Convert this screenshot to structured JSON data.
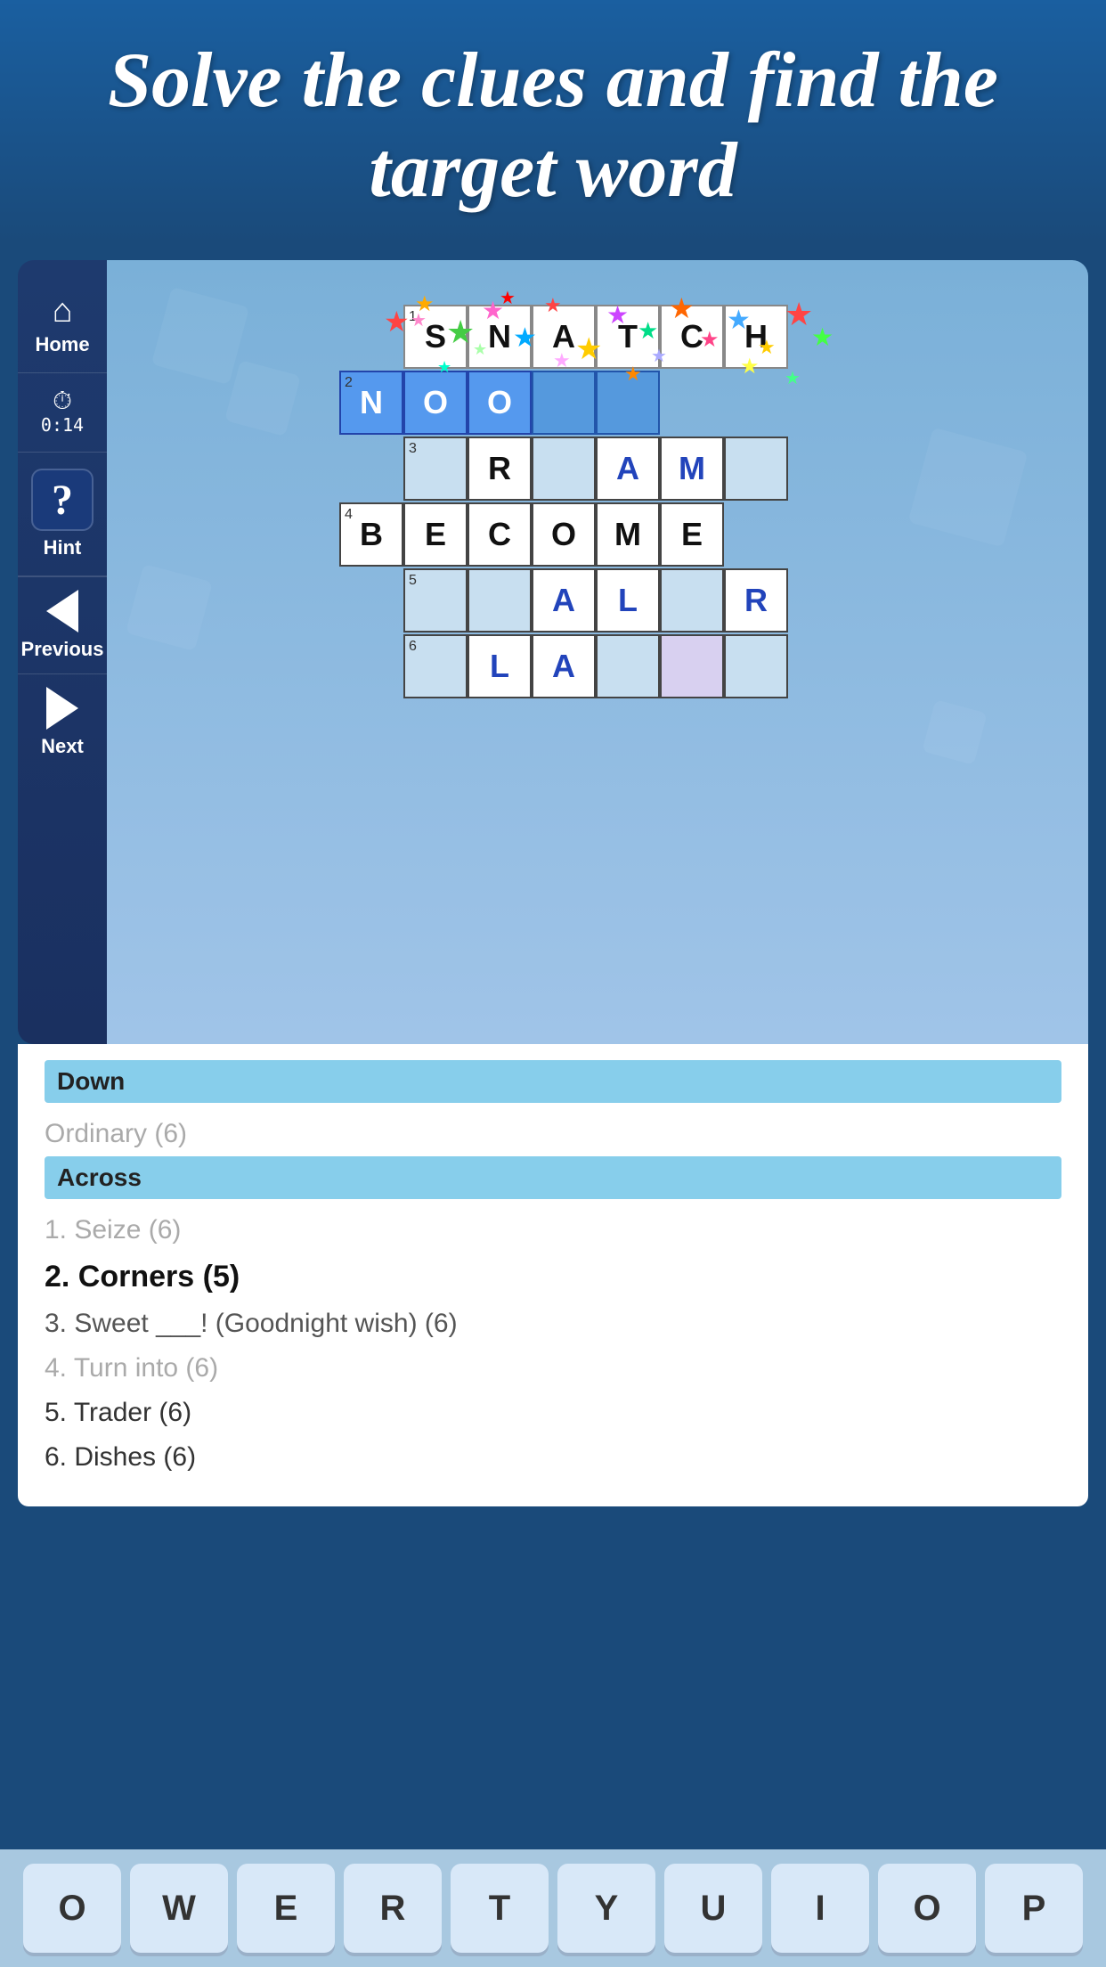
{
  "header": {
    "title": "Solve the clues and find the target word"
  },
  "sidebar": {
    "home_label": "Home",
    "timer_label": "0:14",
    "hint_label": "Hint",
    "hint_symbol": "?",
    "previous_label": "Previous",
    "next_label": "Next"
  },
  "grid": {
    "rows": [
      {
        "clue_num": "1",
        "cells": [
          "S",
          "N",
          "A",
          "T",
          "C",
          "H"
        ]
      },
      {
        "clue_num": "2",
        "cells": [
          "N",
          "O",
          "O",
          "",
          "",
          ""
        ]
      },
      {
        "clue_num": "3",
        "cells": [
          "R",
          "",
          "A",
          "M",
          "",
          ""
        ]
      },
      {
        "clue_num": "4",
        "cells": [
          "B",
          "E",
          "C",
          "O",
          "M",
          "E"
        ]
      },
      {
        "clue_num": "5",
        "cells": [
          "",
          "A",
          "L",
          "",
          "R",
          ""
        ]
      },
      {
        "clue_num": "6",
        "cells": [
          "L",
          "A",
          "",
          "",
          "",
          ""
        ]
      }
    ]
  },
  "clues": {
    "down_header": "Down",
    "down_items": [
      {
        "text": "Ordinary (6)",
        "solved": false,
        "active": false
      }
    ],
    "across_header": "Across",
    "across_items": [
      {
        "num": "1",
        "text": "Seize (6)",
        "solved": true,
        "active": false
      },
      {
        "num": "2",
        "text": "Corners (5)",
        "solved": false,
        "active": true
      },
      {
        "num": "3",
        "text": "Sweet ___! (Goodnight wish) (6)",
        "solved": false,
        "active": false
      },
      {
        "num": "4",
        "text": "Turn into (6)",
        "solved": true,
        "active": false
      },
      {
        "num": "5",
        "text": "Trader (6)",
        "solved": false,
        "active": false
      },
      {
        "num": "6",
        "text": "Dishes (6)",
        "solved": false,
        "active": false
      }
    ]
  },
  "keyboard": {
    "keys": [
      "O",
      "W",
      "E",
      "R",
      "T",
      "Y",
      "U",
      "I",
      "O",
      "P"
    ]
  },
  "colors": {
    "background": "#1a4a7a",
    "sidebar": "#1e3a6e",
    "game_area": "#7ab0d8",
    "clues_bg": "#ffffff",
    "header_bg": "#87ceeb",
    "active_clue": "#111111",
    "solved_clue": "#aaaaaa"
  }
}
